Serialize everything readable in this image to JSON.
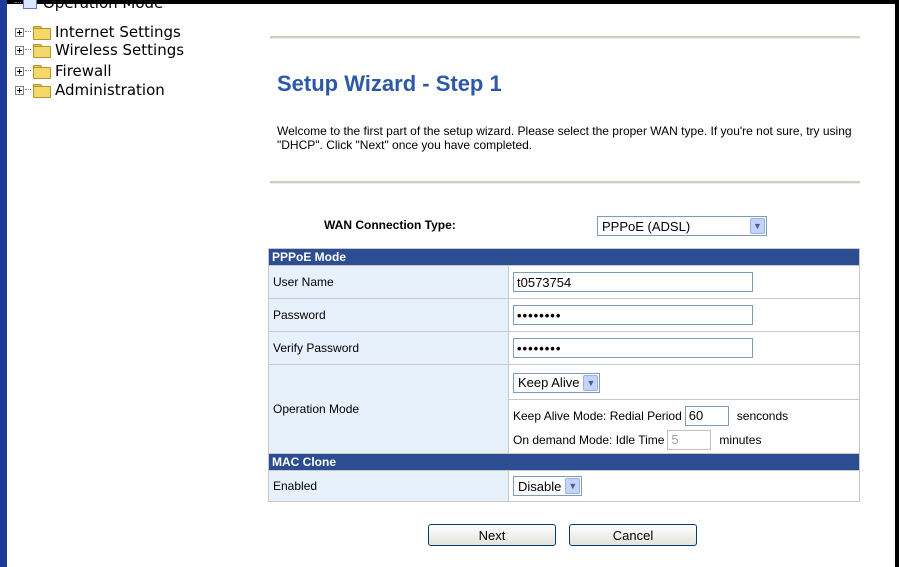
{
  "tree": {
    "items": [
      {
        "label": "Operation Mode"
      },
      {
        "label": "Internet Settings"
      },
      {
        "label": "Wireless Settings"
      },
      {
        "label": "Firewall"
      },
      {
        "label": "Administration"
      }
    ]
  },
  "page": {
    "title": "Setup Wizard - Step 1",
    "description": "Welcome to the first part of the setup wizard. Please select the proper WAN type. If you're not sure, try using \"DHCP\". Click \"Next\" once you have completed."
  },
  "wan": {
    "label": "WAN Connection Type:",
    "selected": "PPPoE (ADSL)"
  },
  "pppoe": {
    "header": "PPPoE Mode",
    "username_label": "User Name",
    "username_value": "t0573754",
    "password_label": "Password",
    "password_value": "••••••••",
    "verify_label": "Verify Password",
    "verify_value": "••••••••",
    "opmode_label": "Operation Mode",
    "opmode_selected": "Keep Alive",
    "keepalive_text": "Keep Alive Mode: Redial Period",
    "keepalive_value": "60",
    "keepalive_unit": "senconds",
    "ondemand_text": "On demand Mode: Idle Time",
    "ondemand_value": "5",
    "ondemand_unit": "minutes"
  },
  "mac": {
    "header": "MAC Clone",
    "enabled_label": "Enabled",
    "enabled_selected": "Disable"
  },
  "buttons": {
    "next": "Next",
    "cancel": "Cancel"
  },
  "colors": {
    "title": "#2b59a8",
    "section_header": "#2d4d92",
    "label_cell": "#e6f1fb",
    "left_frame": "#1e3a9c"
  }
}
